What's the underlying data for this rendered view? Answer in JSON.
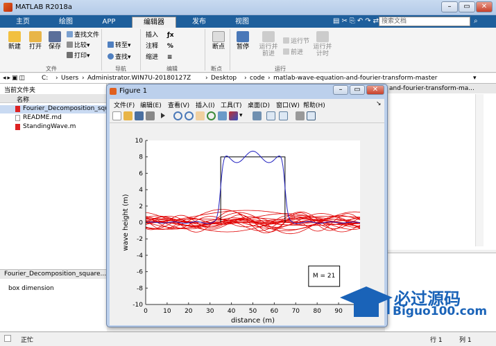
{
  "window": {
    "title": "MATLAB R2018a"
  },
  "tabs": [
    "主页",
    "绘图",
    "APP",
    "编辑器",
    "发布",
    "视图"
  ],
  "search_placeholder": "搜索文档",
  "ribbon": {
    "new": "新建",
    "open": "打开",
    "save": "保存",
    "find_files": "查找文件",
    "compare": "比较",
    "print": "打印",
    "goto": "转至",
    "find": "查找",
    "insert": "插入",
    "comment": "注释",
    "indent": "缩进",
    "breakpoints": "断点",
    "pause": "暂停",
    "run_and_advance": [
      "运行并",
      "前进"
    ],
    "run_section": "运行节",
    "advance": "前进",
    "run_and_time": [
      "运行并",
      "计时"
    ],
    "groups": [
      "文件",
      "导航",
      "编辑",
      "断点",
      "运行"
    ]
  },
  "address": [
    "C:",
    "Users",
    "Administrator.WIN7U-20180127Z",
    "Desktop",
    "code",
    "matlab-wave-equation-and-fourier-transform-master"
  ],
  "file_panel": {
    "title": "当前文件夹",
    "column": "名称",
    "files": [
      "Fourier_Decomposition_squa",
      "README.md",
      "StandingWave.m"
    ]
  },
  "details": {
    "title": "Fourier_Decomposition_square...",
    "text": "box dimension"
  },
  "right_panel_title": "and-fourier-transform-ma...",
  "status": {
    "text": "正忙",
    "row": "行 1",
    "col": "列 1"
  },
  "figure": {
    "title": "Figure 1",
    "menu": [
      "文件(F)",
      "编辑(E)",
      "查看(V)",
      "插入(I)",
      "工具(T)",
      "桌面(D)",
      "窗口(W)",
      "帮助(H)"
    ]
  },
  "watermark": {
    "cn": "必过源码",
    "url": "Biguo100.com"
  },
  "chart_data": {
    "type": "line",
    "xlabel": "distance (m)",
    "ylabel": "wave height (m)",
    "xlim": [
      0,
      100
    ],
    "ylim": [
      -10,
      10
    ],
    "xticks": [
      0,
      10,
      20,
      30,
      40,
      50,
      60,
      70,
      80,
      90,
      100
    ],
    "yticks": [
      -10,
      -8,
      -6,
      -4,
      -2,
      0,
      2,
      4,
      6,
      8,
      10
    ],
    "annotation": "M = 21",
    "colors": {
      "reconstruction": "#2020c0",
      "box": "#000000",
      "components": "#e00000"
    },
    "box": {
      "x": [
        35,
        35,
        65,
        65
      ],
      "y": [
        0,
        8,
        8,
        0
      ]
    },
    "grid": false
  }
}
